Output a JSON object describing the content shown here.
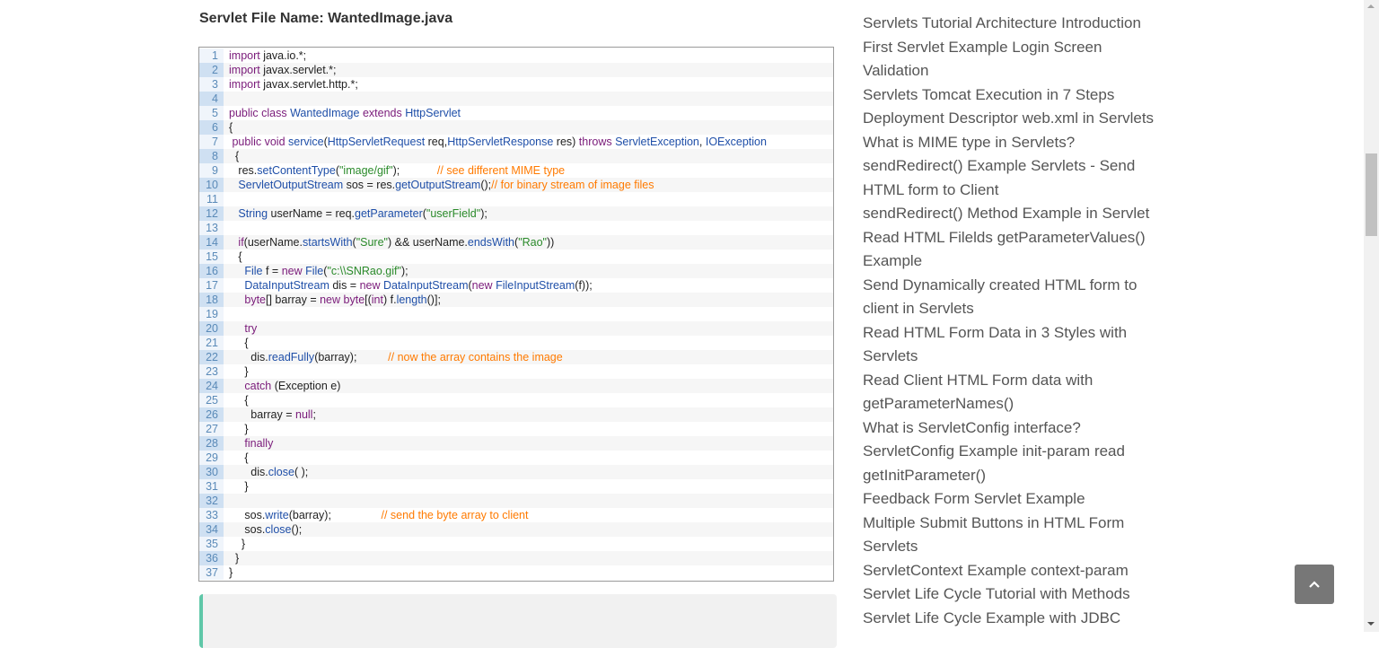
{
  "heading": "Servlet File Name: WantedImage.java",
  "code_lines": [
    [
      [
        "k",
        "import "
      ],
      [
        "p",
        "java.io.*;"
      ]
    ],
    [
      [
        "k",
        "import "
      ],
      [
        "p",
        "javax.servlet.*;"
      ]
    ],
    [
      [
        "k",
        "import "
      ],
      [
        "p",
        "javax.servlet.http.*;"
      ]
    ],
    [],
    [
      [
        "k",
        "public class "
      ],
      [
        "t",
        "WantedImage "
      ],
      [
        "k",
        "extends "
      ],
      [
        "t",
        "HttpServlet"
      ]
    ],
    [
      [
        "p",
        "{"
      ]
    ],
    [
      [
        "k",
        " public void "
      ],
      [
        "t",
        "service"
      ],
      [
        "p",
        "("
      ],
      [
        "t",
        "HttpServletRequest "
      ],
      [
        "p",
        "req,"
      ],
      [
        "t",
        "HttpServletResponse "
      ],
      [
        "p",
        "res) "
      ],
      [
        "k",
        "throws "
      ],
      [
        "t",
        "ServletException"
      ],
      [
        "p",
        ", "
      ],
      [
        "t",
        "IOException"
      ]
    ],
    [
      [
        "p",
        "  {"
      ]
    ],
    [
      [
        "p",
        "   res."
      ],
      [
        "t",
        "setContentType"
      ],
      [
        "p",
        "("
      ],
      [
        "s",
        "\"image/gif\""
      ],
      [
        "p",
        ");            "
      ],
      [
        "c",
        "// see different MIME type"
      ]
    ],
    [
      [
        "t",
        "   ServletOutputStream "
      ],
      [
        "p",
        "sos = res."
      ],
      [
        "t",
        "getOutputStream"
      ],
      [
        "p",
        "();"
      ],
      [
        "c",
        "// for binary stream of image files"
      ]
    ],
    [],
    [
      [
        "t",
        "   String "
      ],
      [
        "p",
        "userName = req."
      ],
      [
        "t",
        "getParameter"
      ],
      [
        "p",
        "("
      ],
      [
        "s",
        "\"userField\""
      ],
      [
        "p",
        ");"
      ]
    ],
    [],
    [
      [
        "k",
        "   if"
      ],
      [
        "p",
        "(userName."
      ],
      [
        "t",
        "startsWith"
      ],
      [
        "p",
        "("
      ],
      [
        "s",
        "\"Sure\""
      ],
      [
        "p",
        ") && userName."
      ],
      [
        "t",
        "endsWith"
      ],
      [
        "p",
        "("
      ],
      [
        "s",
        "\"Rao\""
      ],
      [
        "p",
        "))"
      ]
    ],
    [
      [
        "p",
        "   {"
      ]
    ],
    [
      [
        "t",
        "     File "
      ],
      [
        "p",
        "f = "
      ],
      [
        "k",
        "new "
      ],
      [
        "t",
        "File"
      ],
      [
        "p",
        "("
      ],
      [
        "s",
        "\"c:\\\\SNRao.gif\""
      ],
      [
        "p",
        ");"
      ]
    ],
    [
      [
        "t",
        "     DataInputStream "
      ],
      [
        "p",
        "dis = "
      ],
      [
        "k",
        "new "
      ],
      [
        "t",
        "DataInputStream"
      ],
      [
        "p",
        "("
      ],
      [
        "k",
        "new "
      ],
      [
        "t",
        "FileInputStream"
      ],
      [
        "p",
        "(f));"
      ]
    ],
    [
      [
        "k",
        "     byte"
      ],
      [
        "p",
        "[] barray = "
      ],
      [
        "k",
        "new byte"
      ],
      [
        "p",
        "[("
      ],
      [
        "k",
        "int"
      ],
      [
        "p",
        ") f."
      ],
      [
        "t",
        "length"
      ],
      [
        "p",
        "()];"
      ]
    ],
    [],
    [
      [
        "k",
        "     try"
      ]
    ],
    [
      [
        "p",
        "     {"
      ]
    ],
    [
      [
        "p",
        "       dis."
      ],
      [
        "t",
        "readFully"
      ],
      [
        "p",
        "(barray);          "
      ],
      [
        "c",
        "// now the array contains the image"
      ]
    ],
    [
      [
        "p",
        "     }"
      ]
    ],
    [
      [
        "k",
        "     catch "
      ],
      [
        "p",
        "(Exception e)"
      ]
    ],
    [
      [
        "p",
        "     {"
      ]
    ],
    [
      [
        "p",
        "       barray = "
      ],
      [
        "k",
        "null"
      ],
      [
        "p",
        ";"
      ]
    ],
    [
      [
        "p",
        "     }"
      ]
    ],
    [
      [
        "k",
        "     finally"
      ]
    ],
    [
      [
        "p",
        "     {"
      ]
    ],
    [
      [
        "p",
        "       dis."
      ],
      [
        "t",
        "close"
      ],
      [
        "p",
        "( );"
      ]
    ],
    [
      [
        "p",
        "     }"
      ]
    ],
    [],
    [
      [
        "p",
        "     sos."
      ],
      [
        "t",
        "write"
      ],
      [
        "p",
        "(barray);                "
      ],
      [
        "c",
        "// send the byte array to client"
      ]
    ],
    [
      [
        "p",
        "     sos."
      ],
      [
        "t",
        "close"
      ],
      [
        "p",
        "();"
      ]
    ],
    [
      [
        "p",
        "    }"
      ]
    ],
    [
      [
        "p",
        "  }"
      ]
    ],
    [
      [
        "p",
        "}"
      ]
    ]
  ],
  "sidebar_links": [
    "Servlets Tutorial Architecture Introduction",
    "First Servlet Example Login Screen Validation",
    "Servlets Tomcat Execution in 7 Steps",
    "Deployment Descriptor web.xml in Servlets",
    "What is MIME type in Servlets?",
    "sendRedirect() Example Servlets - Send HTML form to Client",
    "sendRedirect() Method Example in Servlet",
    "Read HTML Filelds getParameterValues() Example",
    "Send Dynamically created HTML form to client in Servlets",
    "Read HTML Form Data in 3 Styles with Servlets",
    "Read Client HTML Form data with getParameterNames()",
    "What is ServletConfig interface?",
    "ServletConfig Example init-param read getInitParameter()",
    "Feedback Form Servlet Example",
    "Multiple Submit Buttons in HTML Form Servlets",
    "ServletContext Example context-param",
    "Servlet Life Cycle Tutorial with Methods",
    "Servlet Life Cycle Example with JDBC"
  ],
  "back_to_top_icon": "chevron-up-icon",
  "colors": {
    "keyword": "#7a1b7a",
    "identifier": "#1f4fa8",
    "string": "#2a8a2a",
    "comment": "#ff7a00",
    "note_accent": "#5fc7a8"
  }
}
